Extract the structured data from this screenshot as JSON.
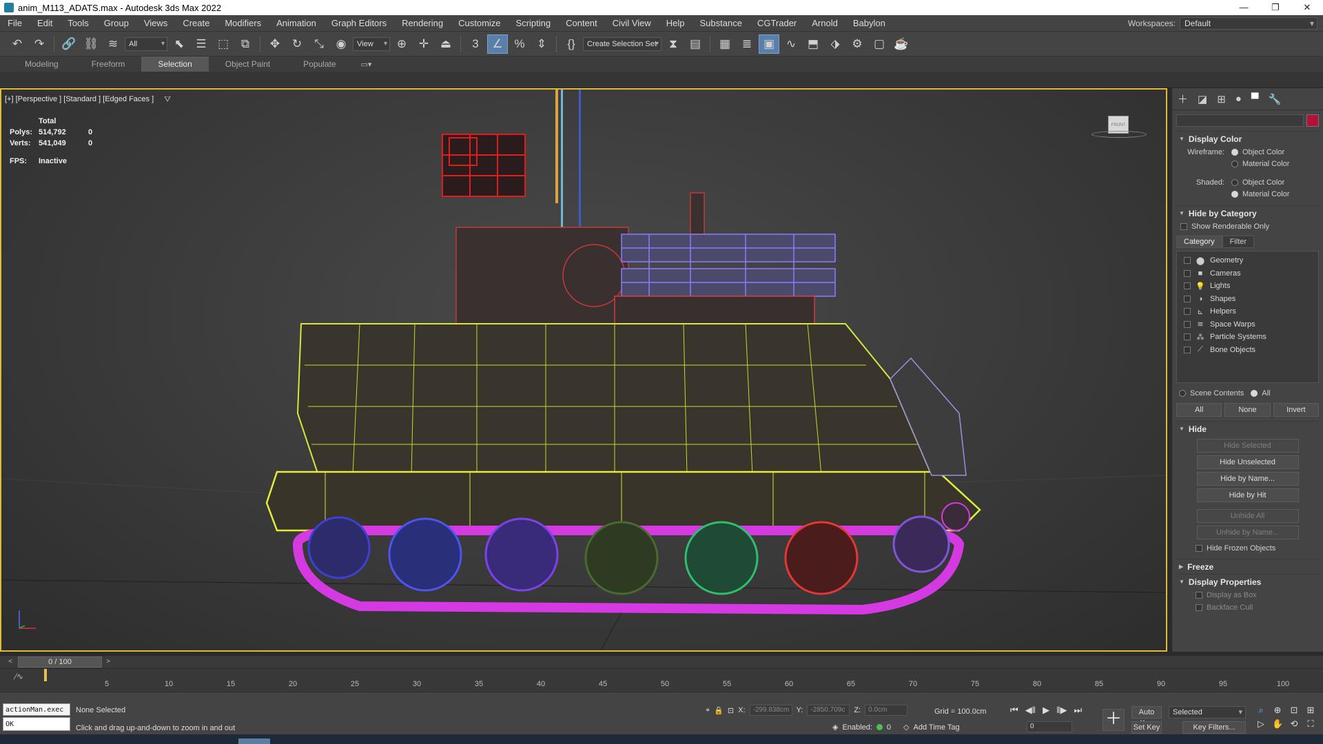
{
  "window": {
    "title": "anim_M113_ADATS.max - Autodesk 3ds Max 2022",
    "controls": [
      "—",
      "❐",
      "✕"
    ]
  },
  "menu": {
    "items": [
      "File",
      "Edit",
      "Tools",
      "Group",
      "Views",
      "Create",
      "Modifiers",
      "Animation",
      "Graph Editors",
      "Rendering",
      "Customize",
      "Scripting",
      "Content",
      "Civil View",
      "Help",
      "Substance",
      "CGTrader",
      "Arnold",
      "Babylon"
    ],
    "workspace_label": "Workspaces:",
    "workspace_value": "Default"
  },
  "toolbar": {
    "filter_value": "All",
    "view_value": "View",
    "selection_set_value": "Create Selection Set"
  },
  "ribbon": {
    "tabs": [
      "Modeling",
      "Freeform",
      "Selection",
      "Object Paint",
      "Populate"
    ],
    "active_tab": "Selection"
  },
  "viewport": {
    "label": "[+] [Perspective ] [Standard ] [Edged Faces ]",
    "stats_header": "Total",
    "polys_label": "Polys:",
    "polys_value": "514,792",
    "polys_sel": "0",
    "verts_label": "Verts:",
    "verts_value": "541,049",
    "verts_sel": "0",
    "fps_label": "FPS:",
    "fps_value": "Inactive",
    "viewcube_label": "FRONT"
  },
  "command_panel": {
    "display_color": {
      "title": "Display Color",
      "wireframe_label": "Wireframe:",
      "shaded_label": "Shaded:",
      "object_color": "Object Color",
      "material_color": "Material Color"
    },
    "hide_by_category": {
      "title": "Hide by Category",
      "show_renderable": "Show Renderable Only",
      "tab_category": "Category",
      "tab_filter": "Filter",
      "categories": [
        "Geometry",
        "Cameras",
        "Lights",
        "Shapes",
        "Helpers",
        "Space Warps",
        "Particle Systems",
        "Bone Objects"
      ],
      "scene_contents": "Scene Contents",
      "all_radio": "All",
      "btn_all": "All",
      "btn_none": "None",
      "btn_invert": "Invert"
    },
    "hide": {
      "title": "Hide",
      "hide_selected": "Hide Selected",
      "hide_unselected": "Hide Unselected",
      "hide_by_name": "Hide by Name...",
      "hide_by_hit": "Hide by Hit",
      "unhide_all": "Unhide All",
      "unhide_by_name": "Unhide by Name...",
      "hide_frozen": "Hide Frozen Objects"
    },
    "freeze": {
      "title": "Freeze"
    },
    "display_properties": {
      "title": "Display Properties",
      "display_as_box": "Display as Box",
      "backface_cull": "Backface Cull"
    }
  },
  "timeline": {
    "slider_label": "0 / 100",
    "ticks": [
      "5",
      "10",
      "15",
      "20",
      "25",
      "30",
      "35",
      "40",
      "45",
      "50",
      "55",
      "60",
      "65",
      "70",
      "75",
      "80",
      "85",
      "90",
      "95",
      "100"
    ]
  },
  "status": {
    "maxscript_line1": "actionMan.exec",
    "maxscript_line2": "OK",
    "selection": "None Selected",
    "prompt": "Click and drag up-and-down to zoom in and out",
    "x_label": "X:",
    "x_value": "-299.838cm",
    "y_label": "Y:",
    "y_value": "-2850.709c",
    "z_label": "Z:",
    "z_value": "0.0cm",
    "grid": "Grid = 100.0cm",
    "enabled_label": "Enabled:",
    "enabled_count": "0",
    "add_time_tag": "Add Time Tag",
    "frame_value": "0",
    "auto_key": "Auto Key",
    "set_key": "Set Key",
    "selected_dropdown": "Selected",
    "key_filters": "Key Filters..."
  }
}
